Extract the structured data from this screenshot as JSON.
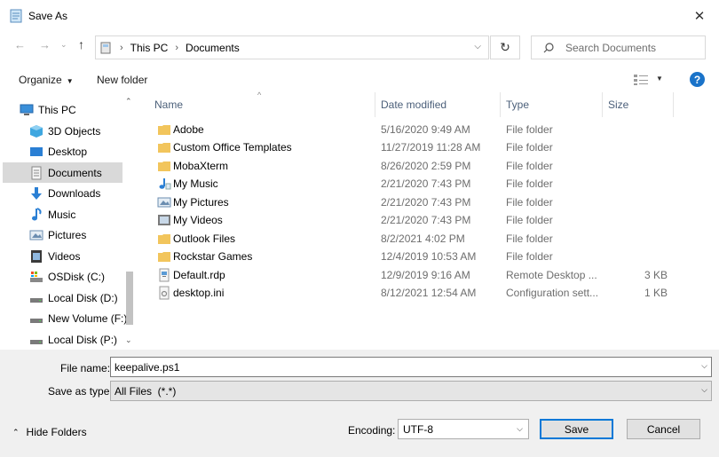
{
  "window": {
    "title": "Save As",
    "close_label": "✕"
  },
  "nav": {
    "path": [
      "This PC",
      "Documents"
    ],
    "search_placeholder": "Search Documents"
  },
  "toolbar": {
    "organize_label": "Organize",
    "new_folder_label": "New folder",
    "help_label": "?"
  },
  "sidebar": {
    "items": [
      {
        "label": "This PC",
        "icon": "pc-icon",
        "selected": false
      },
      {
        "label": "3D Objects",
        "icon": "3d-objects-icon",
        "selected": false
      },
      {
        "label": "Desktop",
        "icon": "desktop-icon",
        "selected": false
      },
      {
        "label": "Documents",
        "icon": "documents-icon",
        "selected": true
      },
      {
        "label": "Downloads",
        "icon": "downloads-icon",
        "selected": false
      },
      {
        "label": "Music",
        "icon": "music-icon",
        "selected": false
      },
      {
        "label": "Pictures",
        "icon": "pictures-icon",
        "selected": false
      },
      {
        "label": "Videos",
        "icon": "videos-icon",
        "selected": false
      },
      {
        "label": "OSDisk (C:)",
        "icon": "os-drive-icon",
        "selected": false
      },
      {
        "label": "Local Disk (D:)",
        "icon": "drive-icon",
        "selected": false
      },
      {
        "label": "New Volume (F:)",
        "icon": "drive-icon",
        "selected": false
      },
      {
        "label": "Local Disk (P:)",
        "icon": "drive-icon",
        "selected": false
      }
    ]
  },
  "columns": {
    "name": "Name",
    "date": "Date modified",
    "type": "Type",
    "size": "Size"
  },
  "files": [
    {
      "name": "Adobe",
      "date": "5/16/2020 9:49 AM",
      "type": "File folder",
      "size": "",
      "icon": "folder-icon"
    },
    {
      "name": "Custom Office Templates",
      "date": "11/27/2019 11:28 AM",
      "type": "File folder",
      "size": "",
      "icon": "folder-icon"
    },
    {
      "name": "MobaXterm",
      "date": "8/26/2020 2:59 PM",
      "type": "File folder",
      "size": "",
      "icon": "folder-icon"
    },
    {
      "name": "My Music",
      "date": "2/21/2020 7:43 PM",
      "type": "File folder",
      "size": "",
      "icon": "music-folder-icon"
    },
    {
      "name": "My Pictures",
      "date": "2/21/2020 7:43 PM",
      "type": "File folder",
      "size": "",
      "icon": "pictures-folder-icon"
    },
    {
      "name": "My Videos",
      "date": "2/21/2020 7:43 PM",
      "type": "File folder",
      "size": "",
      "icon": "videos-folder-icon"
    },
    {
      "name": "Outlook Files",
      "date": "8/2/2021 4:02 PM",
      "type": "File folder",
      "size": "",
      "icon": "folder-icon"
    },
    {
      "name": "Rockstar Games",
      "date": "12/4/2019 10:53 AM",
      "type": "File folder",
      "size": "",
      "icon": "folder-icon"
    },
    {
      "name": "Default.rdp",
      "date": "12/9/2019 9:16 AM",
      "type": "Remote Desktop ...",
      "size": "3 KB",
      "icon": "rdp-file-icon"
    },
    {
      "name": "desktop.ini",
      "date": "8/12/2021 12:54 AM",
      "type": "Configuration sett...",
      "size": "1 KB",
      "icon": "ini-file-icon"
    }
  ],
  "form": {
    "file_name_label": "File name:",
    "file_name_value": "keepalive.ps1",
    "save_as_type_label": "Save as type:",
    "save_as_type_value": "All Files  (*.*)",
    "hide_folders_label": "Hide Folders",
    "encoding_label": "Encoding:",
    "encoding_value": "UTF-8",
    "save_label": "Save",
    "cancel_label": "Cancel"
  },
  "colors": {
    "accent": "#0078d7",
    "selection": "#d9d9d9",
    "folder": "#f2c55c"
  }
}
